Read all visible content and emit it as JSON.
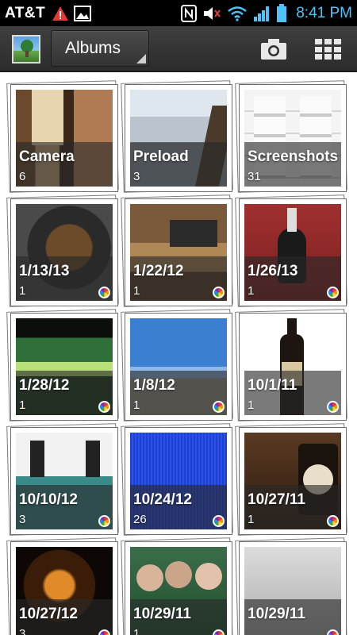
{
  "status_bar": {
    "carrier": "AT&T",
    "time": "8:41 PM",
    "left_icons": [
      "warning-icon",
      "image-notification-icon"
    ],
    "right_icons": [
      "nfc-icon",
      "mute-icon",
      "wifi-icon",
      "signal-icon",
      "battery-icon"
    ],
    "colors": {
      "time": "#4fc3f7",
      "battery": "#4fc3f7"
    }
  },
  "action_bar": {
    "app_icon": "gallery-app-icon",
    "dropdown_label": "Albums",
    "actions": [
      "camera-icon",
      "grid-view-icon"
    ]
  },
  "albums": [
    {
      "name": "Camera",
      "count": "6",
      "picasa": false,
      "theme": "room"
    },
    {
      "name": "Preload",
      "count": "3",
      "picasa": false,
      "theme": "city"
    },
    {
      "name": "Screenshots",
      "count": "31",
      "picasa": false,
      "theme": "screenshot"
    },
    {
      "name": "1/13/13",
      "count": "1",
      "picasa": true,
      "theme": "pot"
    },
    {
      "name": "1/22/12",
      "count": "1",
      "picasa": true,
      "theme": "desk"
    },
    {
      "name": "1/26/13",
      "count": "1",
      "picasa": true,
      "theme": "bottle-red"
    },
    {
      "name": "1/28/12",
      "count": "1",
      "picasa": true,
      "theme": "concert"
    },
    {
      "name": "1/8/12",
      "count": "1",
      "picasa": true,
      "theme": "sky"
    },
    {
      "name": "10/1/11",
      "count": "1",
      "picasa": true,
      "theme": "beer"
    },
    {
      "name": "10/10/12",
      "count": "3",
      "picasa": true,
      "theme": "speakers"
    },
    {
      "name": "10/24/12",
      "count": "26",
      "picasa": true,
      "theme": "blue"
    },
    {
      "name": "10/27/11",
      "count": "1",
      "picasa": true,
      "theme": "pub"
    },
    {
      "name": "10/27/12",
      "count": "3",
      "picasa": true,
      "theme": "pumpkin"
    },
    {
      "name": "10/29/11",
      "count": "1",
      "picasa": true,
      "theme": "people"
    },
    {
      "name": "10/29/11",
      "count": "",
      "picasa": true,
      "theme": "snow"
    }
  ]
}
